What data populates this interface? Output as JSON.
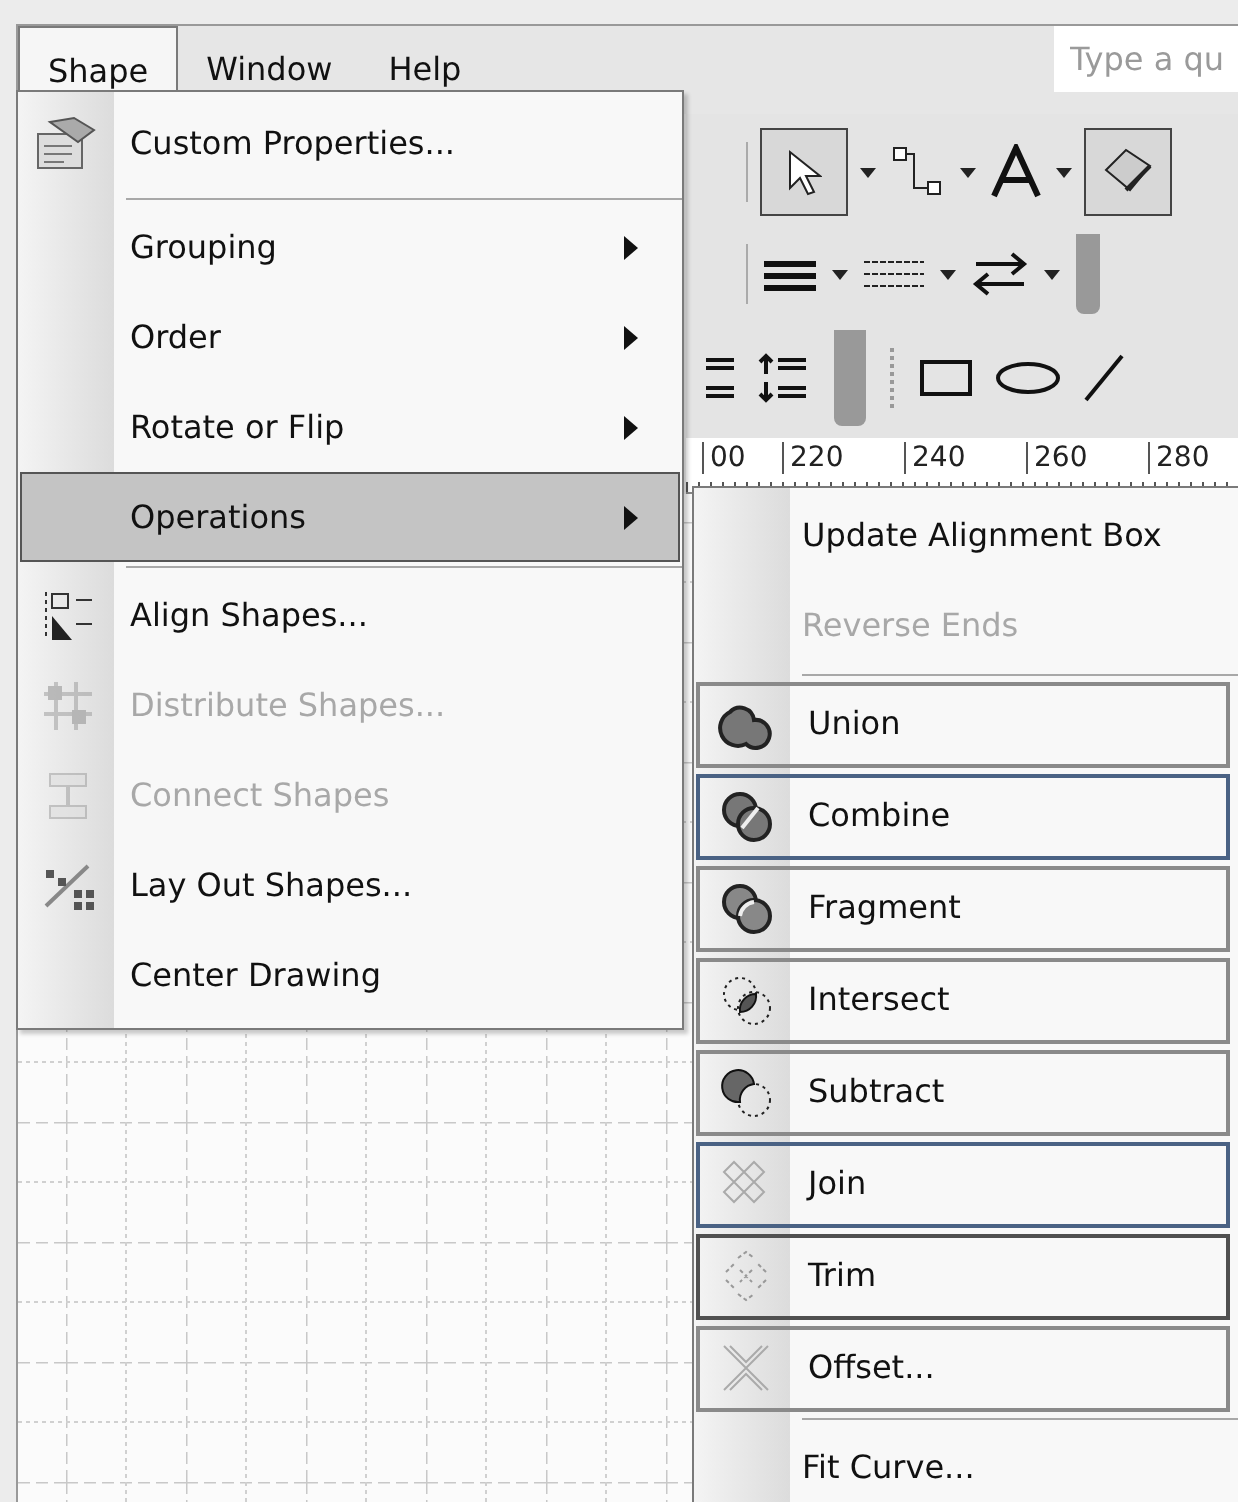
{
  "menu_bar": {
    "items": [
      {
        "label": "Shape",
        "selected": true
      },
      {
        "label": "Window",
        "selected": false
      },
      {
        "label": "Help",
        "selected": false
      }
    ],
    "search": {
      "placeholder": "Type a qu"
    }
  },
  "ruler": {
    "labels": [
      "00",
      "220",
      "240",
      "260",
      "280"
    ]
  },
  "shape_menu": {
    "items": [
      {
        "kind": "command",
        "label": "Custom Properties...",
        "submenu": false,
        "disabled": false,
        "selected": false
      },
      {
        "kind": "separator"
      },
      {
        "kind": "command",
        "label": "Grouping",
        "submenu": true,
        "disabled": false,
        "selected": false
      },
      {
        "kind": "command",
        "label": "Order",
        "submenu": true,
        "disabled": false,
        "selected": false
      },
      {
        "kind": "command",
        "label": "Rotate or Flip",
        "submenu": true,
        "disabled": false,
        "selected": false
      },
      {
        "kind": "command",
        "label": "Operations",
        "submenu": true,
        "disabled": false,
        "selected": true
      },
      {
        "kind": "separator"
      },
      {
        "kind": "command",
        "label": "Align Shapes...",
        "submenu": false,
        "disabled": false,
        "selected": false
      },
      {
        "kind": "command",
        "label": "Distribute Shapes...",
        "submenu": false,
        "disabled": true,
        "selected": false
      },
      {
        "kind": "command",
        "label": "Connect Shapes",
        "submenu": false,
        "disabled": true,
        "selected": false
      },
      {
        "kind": "command",
        "label": "Lay Out Shapes...",
        "submenu": false,
        "disabled": false,
        "selected": false
      },
      {
        "kind": "command",
        "label": "Center Drawing",
        "submenu": false,
        "disabled": false,
        "selected": false
      }
    ]
  },
  "operations_menu": {
    "items": [
      {
        "kind": "command",
        "label": "Update Alignment Box",
        "disabled": false
      },
      {
        "kind": "command",
        "label": "Reverse Ends",
        "disabled": true
      },
      {
        "kind": "separator"
      },
      {
        "kind": "tool",
        "label": "Union",
        "disabled": false,
        "highlighted": false,
        "pressed": false
      },
      {
        "kind": "tool",
        "label": "Combine",
        "disabled": false,
        "highlighted": true,
        "pressed": false
      },
      {
        "kind": "tool",
        "label": "Fragment",
        "disabled": false,
        "highlighted": false,
        "pressed": false
      },
      {
        "kind": "tool",
        "label": "Intersect",
        "disabled": false,
        "highlighted": false,
        "pressed": false
      },
      {
        "kind": "tool",
        "label": "Subtract",
        "disabled": false,
        "highlighted": false,
        "pressed": false
      },
      {
        "kind": "tool",
        "label": "Join",
        "disabled": false,
        "highlighted": true,
        "pressed": false
      },
      {
        "kind": "tool",
        "label": "Trim",
        "disabled": false,
        "highlighted": false,
        "pressed": true
      },
      {
        "kind": "tool",
        "label": "Offset...",
        "disabled": false,
        "highlighted": false,
        "pressed": false
      },
      {
        "kind": "separator"
      },
      {
        "kind": "command",
        "label": "Fit Curve...",
        "disabled": false
      }
    ]
  }
}
